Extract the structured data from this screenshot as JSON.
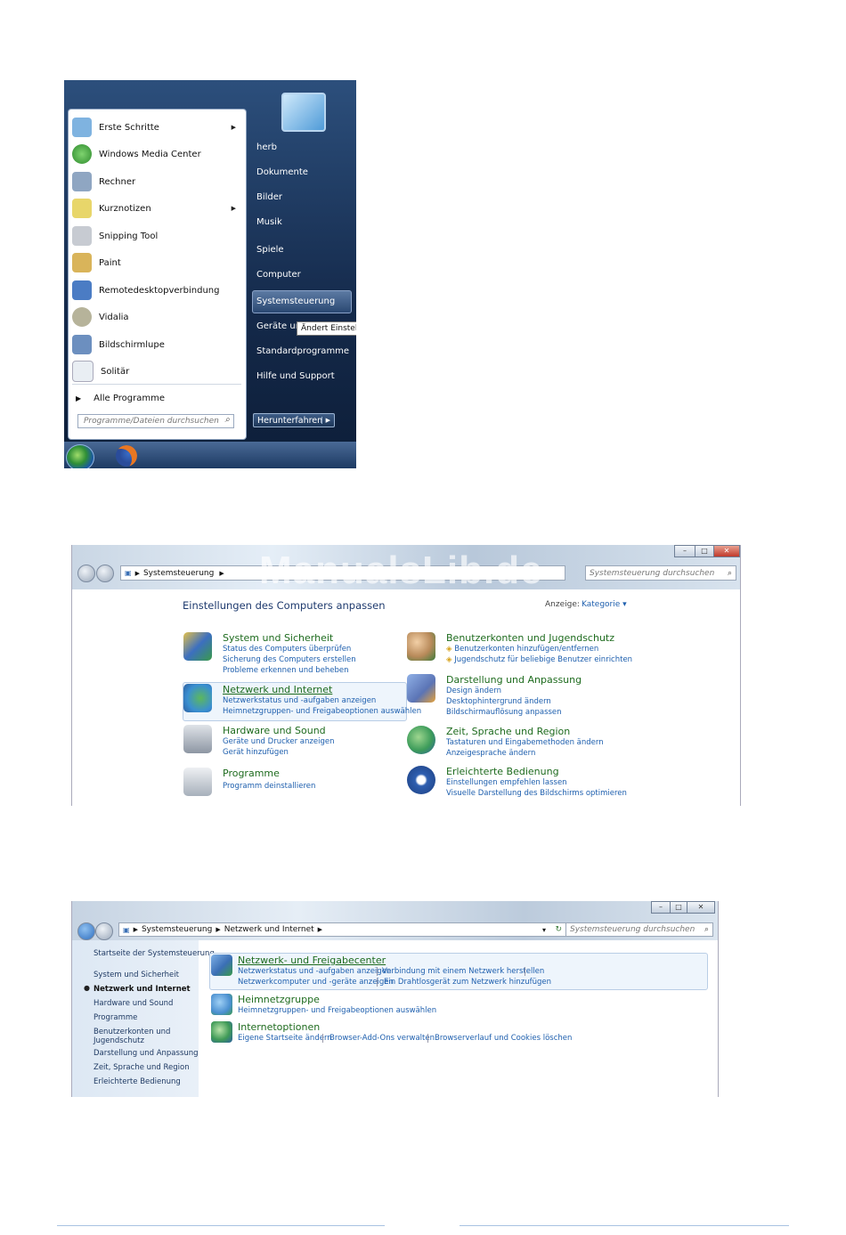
{
  "start_menu": {
    "programs": [
      {
        "label": "Erste Schritte",
        "icon": "getting-started-icon",
        "submenu": true,
        "color": "#7fb3e0"
      },
      {
        "label": "Windows Media Center",
        "icon": "media-center-icon",
        "submenu": false,
        "color": "#3c9a3c"
      },
      {
        "label": "Rechner",
        "icon": "calculator-icon",
        "submenu": false,
        "color": "#8fa6c2"
      },
      {
        "label": "Kurznotizen",
        "icon": "sticky-notes-icon",
        "submenu": true,
        "color": "#e8d66a"
      },
      {
        "label": "Snipping Tool",
        "icon": "scissors-icon",
        "submenu": false,
        "color": "#c7cbd2"
      },
      {
        "label": "Paint",
        "icon": "paint-icon",
        "submenu": false,
        "color": "#d9b45a"
      },
      {
        "label": "Remotedesktopverbindung",
        "icon": "remote-desktop-icon",
        "submenu": false,
        "color": "#4b7cc4"
      },
      {
        "label": "Vidalia",
        "icon": "onion-icon",
        "submenu": false,
        "color": "#b6b39a"
      },
      {
        "label": "Bildschirmlupe",
        "icon": "magnifier-icon",
        "submenu": false,
        "color": "#6c8fbf"
      },
      {
        "label": "Solitär",
        "icon": "cards-icon",
        "submenu": false,
        "color": "#e9eef3"
      }
    ],
    "all_programs": "Alle Programme",
    "search_placeholder": "Programme/Dateien durchsuchen",
    "right_items": [
      "herb",
      "Dokumente",
      "Bilder",
      "Musik",
      "Spiele",
      "Computer",
      "Systemsteuerung",
      "Geräte und",
      "Standardprogramme",
      "Hilfe und Support"
    ],
    "tooltip": "Ändert Einstellu",
    "shutdown": "Herunterfahren"
  },
  "window1": {
    "watermark": "ManualsLib.de",
    "breadcrumb": "Systemsteuerung",
    "search_placeholder": "Systemsteuerung durchsuchen",
    "heading": "Einstellungen des Computers anpassen",
    "view_label": "Anzeige:",
    "view_value": "Kategorie",
    "categories": [
      {
        "title": "System und Sicherheit",
        "icon": "shield-icon",
        "color": "#3c6fc0",
        "links": [
          "Status des Computers überprüfen",
          "Sicherung des Computers erstellen",
          "Probleme erkennen und beheben"
        ]
      },
      {
        "title": "Netzwerk und Internet",
        "icon": "network-globe-icon",
        "color": "#3a8fd1",
        "links": [
          "Netzwerkstatus und -aufgaben anzeigen",
          "Heimnetzgruppen- und Freigabeoptionen auswählen"
        ]
      },
      {
        "title": "Hardware und Sound",
        "icon": "printer-icon",
        "color": "#8d96a3",
        "links": [
          "Geräte und Drucker anzeigen",
          "Gerät hinzufügen"
        ]
      },
      {
        "title": "Programme",
        "icon": "programs-icon",
        "color": "#a7b0bb",
        "links": [
          "Programm deinstallieren"
        ]
      },
      {
        "title": "Benutzerkonten und Jugendschutz",
        "icon": "users-icon",
        "color": "#b88a5a",
        "links": [
          "Benutzerkonten hinzufügen/entfernen",
          "Jugendschutz für beliebige Benutzer einrichten"
        ]
      },
      {
        "title": "Darstellung und Anpassung",
        "icon": "display-icon",
        "color": "#5b74b5",
        "links": [
          "Design ändern",
          "Desktophintergrund ändern",
          "Bildschirmauflösung anpassen"
        ]
      },
      {
        "title": "Zeit, Sprache und Region",
        "icon": "globe-clock-icon",
        "color": "#3d9c5a",
        "links": [
          "Tastaturen und Eingabemethoden ändern",
          "Anzeigesprache ändern"
        ]
      },
      {
        "title": "Erleichterte Bedienung",
        "icon": "accessibility-icon",
        "color": "#2f5fb0",
        "links": [
          "Einstellungen empfehlen lassen",
          "Visuelle Darstellung des Bildschirms optimieren"
        ]
      }
    ]
  },
  "window2": {
    "breadcrumb": [
      "Systemsteuerung",
      "Netzwerk und Internet"
    ],
    "search_placeholder": "Systemsteuerung durchsuchen",
    "sidebar": [
      "Startseite der Systemsteuerung",
      "System und Sicherheit",
      "Netzwerk und Internet",
      "Hardware und Sound",
      "Programme",
      "Benutzerkonten und",
      "Jugendschutz",
      "Darstellung und Anpassung",
      "Zeit, Sprache und Region",
      "Erleichterte Bedienung"
    ],
    "sections": [
      {
        "title": "Netzwerk- und Freigabecenter",
        "icon": "network-center-icon",
        "color": "#3b6fb5",
        "links": [
          "Netzwerkstatus und -aufgaben anzeigen",
          "Verbindung mit einem Netzwerk herstellen",
          "Netzwerkcomputer und -geräte anzeigen",
          "Ein Drahtlosgerät zum Netzwerk hinzufügen"
        ]
      },
      {
        "title": "Heimnetzgruppe",
        "icon": "homegroup-icon",
        "color": "#4a8fd0",
        "links": [
          "Heimnetzgruppen- und Freigabeoptionen auswählen"
        ]
      },
      {
        "title": "Internetoptionen",
        "icon": "internet-options-icon",
        "color": "#3f9a57",
        "links": [
          "Eigene Startseite ändern",
          "Browser-Add-Ons verwalten",
          "Browserverlauf und Cookies löschen"
        ]
      }
    ]
  }
}
